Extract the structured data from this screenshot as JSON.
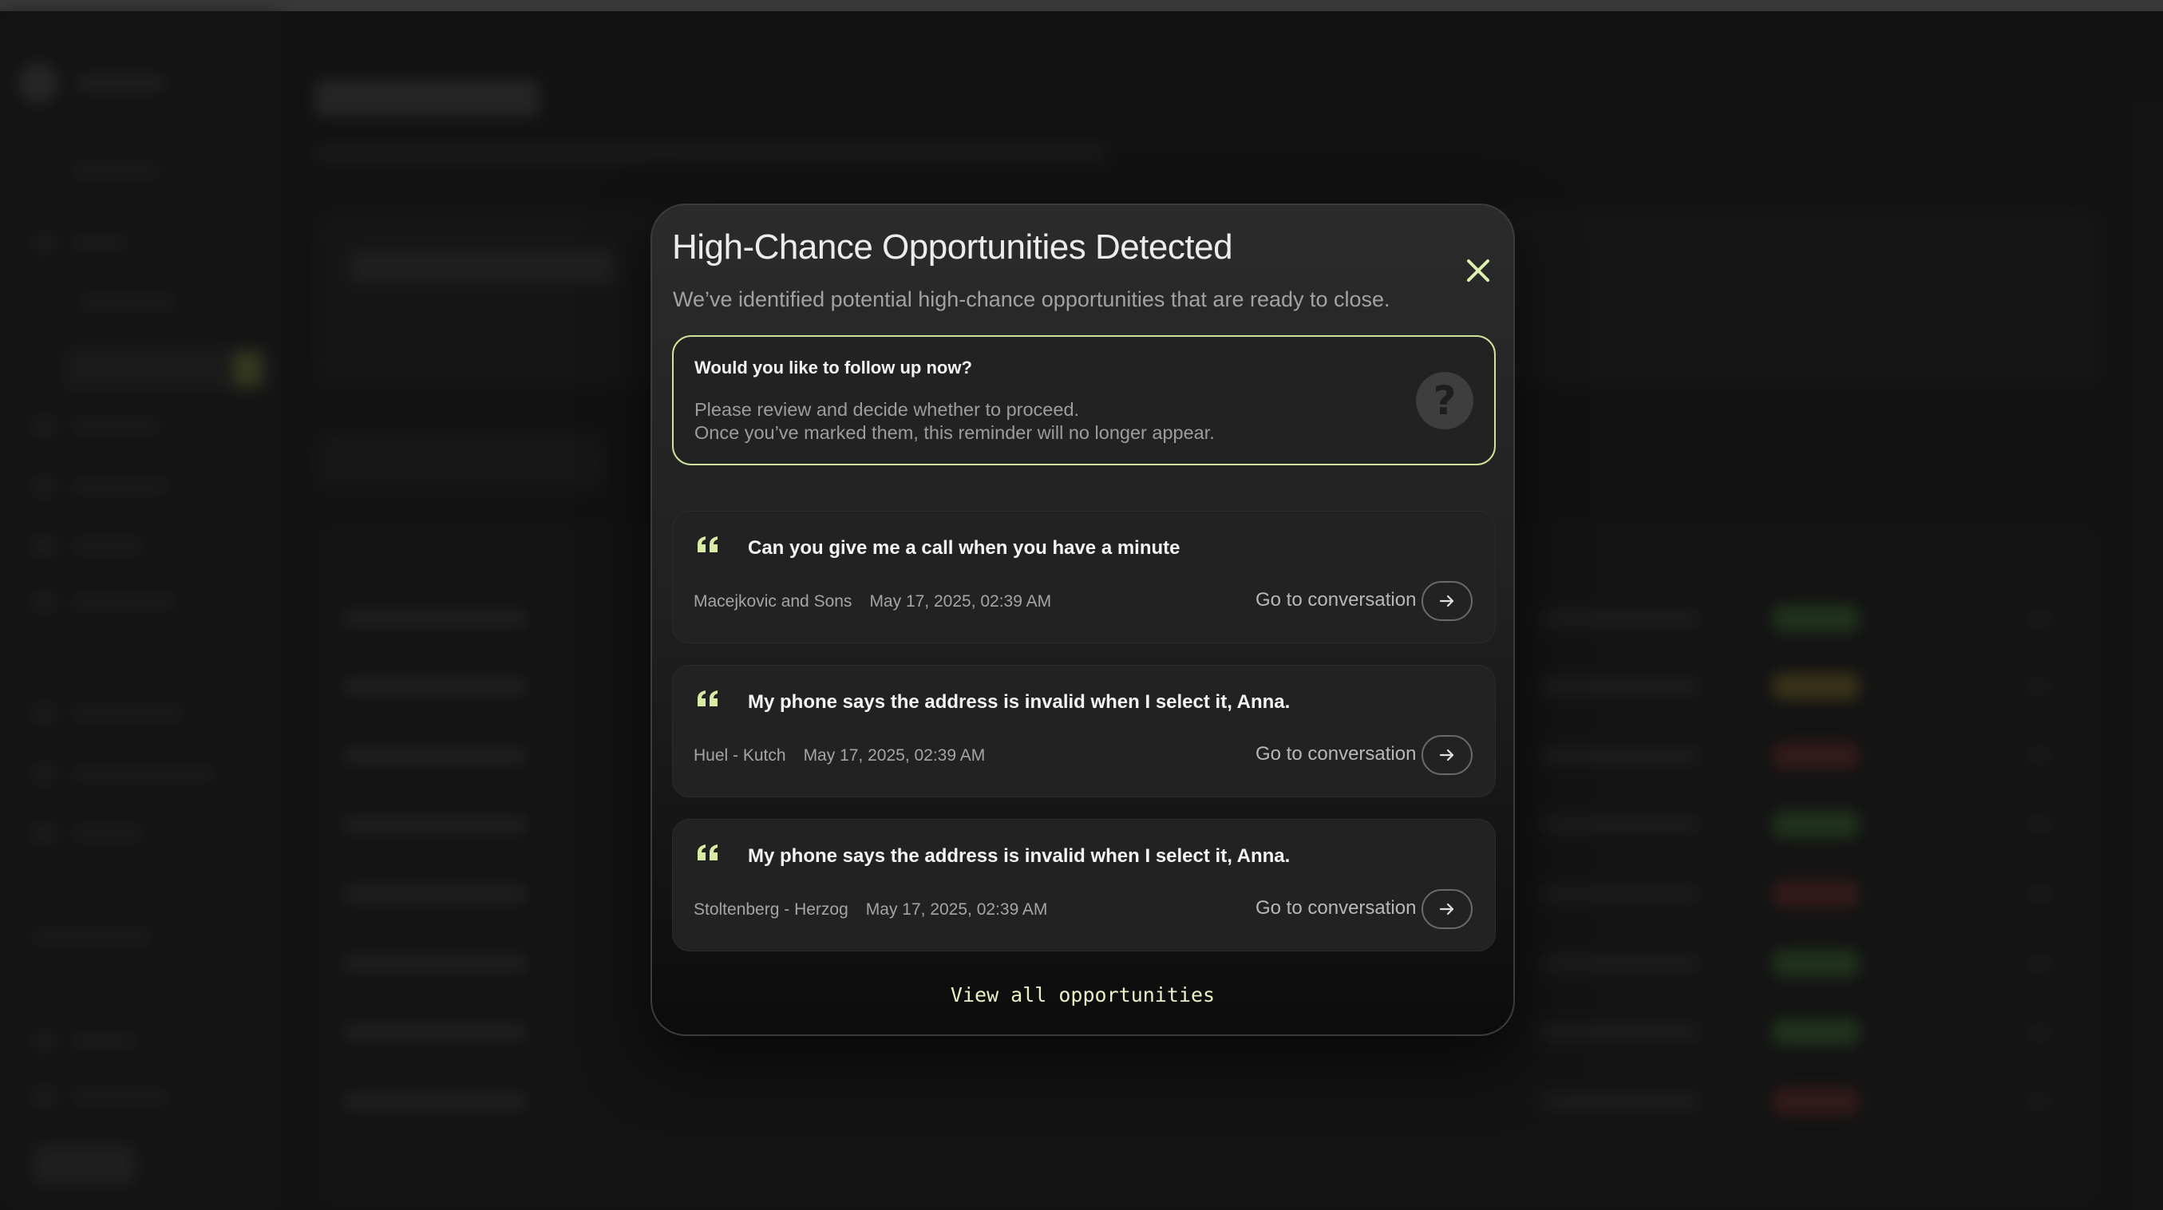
{
  "modal": {
    "title": "High-Chance Opportunities Detected",
    "subtitle": "We’ve identified potential high-chance opportunities that are ready to close.",
    "close_icon": "close-icon",
    "accent_color": "#cfe39a",
    "callout": {
      "question": "Would you like to follow up now?",
      "line1": "Please review and decide whether to proceed.",
      "line2": "Once you’ve marked them, this reminder will no longer appear.",
      "icon": "question-circle-icon"
    },
    "opportunities": [
      {
        "message": "Can you give me a call when you have a minute",
        "company": "Macejkovic and Sons",
        "date": "May 17, 2025, 02:39 AM",
        "link_label": "Go to conversation"
      },
      {
        "message": "My phone says the address is invalid when I select it, Anna.",
        "company": "Huel - Kutch",
        "date": "May 17, 2025, 02:39 AM",
        "link_label": "Go to conversation"
      },
      {
        "message": "My phone says the address is invalid when I select it, Anna.",
        "company": "Stoltenberg - Herzog",
        "date": "May 17, 2025, 02:39 AM",
        "link_label": "Go to conversation"
      }
    ],
    "view_all_label": "View all opportunities"
  }
}
